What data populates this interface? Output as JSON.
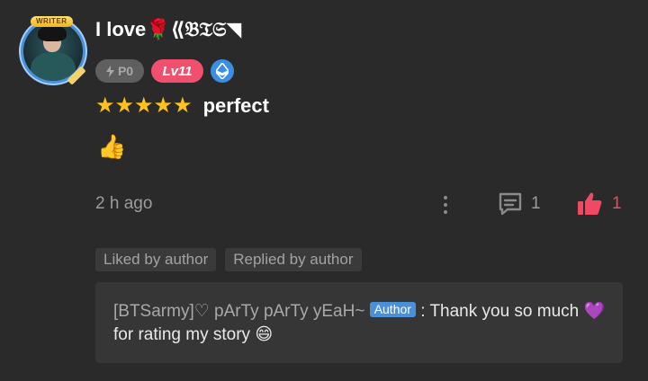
{
  "user": {
    "name": "I love🌹⟪𝔅𝔗𝔖◥",
    "writer_badge": "WRITER",
    "points_badge": "P0",
    "level_badge": "Lv11"
  },
  "review": {
    "stars": "★★★★★",
    "rating_text": "perfect",
    "body_emoji": "👍"
  },
  "meta": {
    "time": "2 h ago",
    "comment_count": "1",
    "like_count": "1"
  },
  "tags": {
    "liked": "Liked by author",
    "replied": "Replied by author"
  },
  "reply": {
    "name": "[BTSarmy]♡ pArTy pArTy yEaH~",
    "author_badge": "Author",
    "separator": " : ",
    "text": "Thank you so much 💜 for rating my story 😄"
  },
  "colors": {
    "background": "#2a2a2b",
    "like": "#ee4a64",
    "level": "#f0506e",
    "star": "#ffc21a",
    "author": "#4a90d9"
  }
}
